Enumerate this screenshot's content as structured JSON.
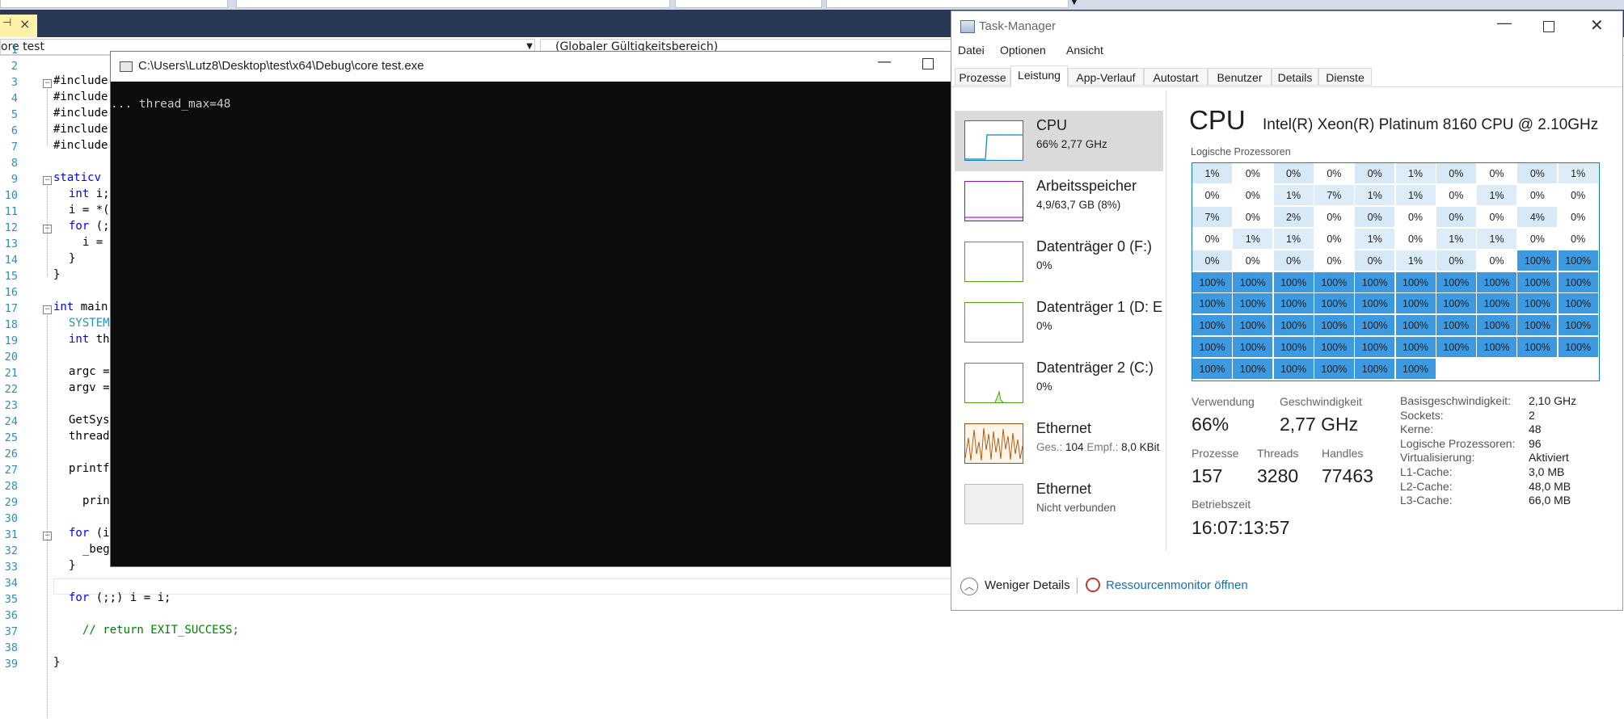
{
  "vs": {
    "scope_left": "ore test",
    "scope_right": "(Globaler Gültigkeitsbereich)",
    "line_numbers": [
      "1",
      "2",
      "3",
      "4",
      "5",
      "6",
      "7",
      "8",
      "9",
      "10",
      "11",
      "12",
      "13",
      "14",
      "15",
      "16",
      "17",
      "18",
      "19",
      "20",
      "21",
      "22",
      "23",
      "24",
      "25",
      "26",
      "27",
      "28",
      "29",
      "30",
      "31",
      "32",
      "33",
      "34",
      "35",
      "36",
      "37",
      "38",
      "39"
    ],
    "lines": {
      "l2": "#include",
      "l3": "#include",
      "l4": "#include",
      "l5": "#include",
      "l6": "#include",
      "l8_kw": "static",
      "l8_rest": "v",
      "l9_kw": "int",
      "l9_rest": " i;",
      "l10": "i = *(",
      "l11_kw": "for",
      "l11_rest": " (;",
      "l12": "i =",
      "l13": "}",
      "l14": "}",
      "l16_kw": "int",
      "l16_rest": " main",
      "l17": "SYSTEM",
      "l18_kw": "int",
      "l18_rest": " th",
      "l20": "argc =",
      "l21": "argv =",
      "l23": "GetSys",
      "l24": "thread",
      "l26": "printf",
      "l28": "prin",
      "l30_kw": "for",
      "l30_rest": " (i",
      "l31": "_beg",
      "l32": "}",
      "l34_kw": "for",
      "l34_rest": " (;;) i = i;",
      "l36": "// return EXIT_SUCCESS;",
      "l38": "}"
    }
  },
  "console": {
    "title": "C:\\Users\\Lutz8\\Desktop\\test\\x64\\Debug\\core test.exe",
    "output": "... thread_max=48"
  },
  "taskmanager": {
    "title": "Task-Manager",
    "menu": [
      "Datei",
      "Optionen",
      "Ansicht"
    ],
    "tabs": [
      "Prozesse",
      "Leistung",
      "App-Verlauf",
      "Autostart",
      "Benutzer",
      "Details",
      "Dienste"
    ],
    "active_tab": "Leistung",
    "resources": [
      {
        "name": "CPU",
        "sub": "66% 2,77 GHz",
        "color": "#117dbb"
      },
      {
        "name": "Arbeitsspeicher",
        "sub": "4,9/63,7 GB (8%)",
        "color": "#8b12ae"
      },
      {
        "name": "Datenträger 0 (F:)",
        "sub": "0%",
        "color": "#4da60c"
      },
      {
        "name": "Datenträger 1 (D: E",
        "sub": "0%",
        "color": "#4da60c"
      },
      {
        "name": "Datenträger 2 (C:)",
        "sub": "0%",
        "color": "#4da60c"
      },
      {
        "name": "Ethernet",
        "sub_label1": "Ges.:",
        "sub_val1": "104",
        "sub_label2": "Empf.:",
        "sub_val2": "8,0 KBit",
        "color": "#a74f01"
      },
      {
        "name": "Ethernet",
        "sub": "Nicht verbunden",
        "color": "#999999"
      }
    ],
    "cpu": {
      "title": "CPU",
      "model": "Intel(R) Xeon(R) Platinum 8160 CPU @ 2.10GHz",
      "logical_label": "Logische Prozessoren",
      "cores": [
        "1%",
        "0%",
        "0%",
        "0%",
        "0%",
        "1%",
        "0%",
        "0%",
        "0%",
        "1%",
        "0%",
        "0%",
        "1%",
        "7%",
        "1%",
        "1%",
        "0%",
        "1%",
        "0%",
        "0%",
        "7%",
        "0%",
        "2%",
        "0%",
        "0%",
        "0%",
        "0%",
        "0%",
        "4%",
        "0%",
        "0%",
        "1%",
        "1%",
        "0%",
        "1%",
        "0%",
        "1%",
        "1%",
        "0%",
        "0%",
        "0%",
        "0%",
        "0%",
        "0%",
        "0%",
        "1%",
        "0%",
        "0%",
        "100%",
        "100%",
        "100%",
        "100%",
        "100%",
        "100%",
        "100%",
        "100%",
        "100%",
        "100%",
        "100%",
        "100%",
        "100%",
        "100%",
        "100%",
        "100%",
        "100%",
        "100%",
        "100%",
        "100%",
        "100%",
        "100%",
        "100%",
        "100%",
        "100%",
        "100%",
        "100%",
        "100%",
        "100%",
        "100%",
        "100%",
        "100%",
        "100%",
        "100%",
        "100%",
        "100%",
        "100%",
        "100%",
        "100%",
        "100%",
        "100%",
        "100%",
        "100%",
        "100%",
        "100%",
        "100%",
        "100%",
        "100%"
      ],
      "stats": {
        "usage_label": "Verwendung",
        "usage": "66%",
        "speed_label": "Geschwindigkeit",
        "speed": "2,77 GHz",
        "processes_label": "Prozesse",
        "processes": "157",
        "threads_label": "Threads",
        "threads": "3280",
        "handles_label": "Handles",
        "handles": "77463",
        "uptime_label": "Betriebszeit",
        "uptime": "16:07:13:57"
      },
      "specs": [
        {
          "k": "Basisgeschwindigkeit:",
          "v": "2,10 GHz"
        },
        {
          "k": "Sockets:",
          "v": "2"
        },
        {
          "k": "Kerne:",
          "v": "48"
        },
        {
          "k": "Logische Prozessoren:",
          "v": "96"
        },
        {
          "k": "Virtualisierung:",
          "v": "Aktiviert"
        },
        {
          "k": "L1-Cache:",
          "v": "3,0 MB"
        },
        {
          "k": "L2-Cache:",
          "v": "48,0 MB"
        },
        {
          "k": "L3-Cache:",
          "v": "66,0 MB"
        }
      ]
    },
    "footer": {
      "less": "Weniger Details",
      "resmon": "Ressourcenmonitor öffnen"
    }
  }
}
